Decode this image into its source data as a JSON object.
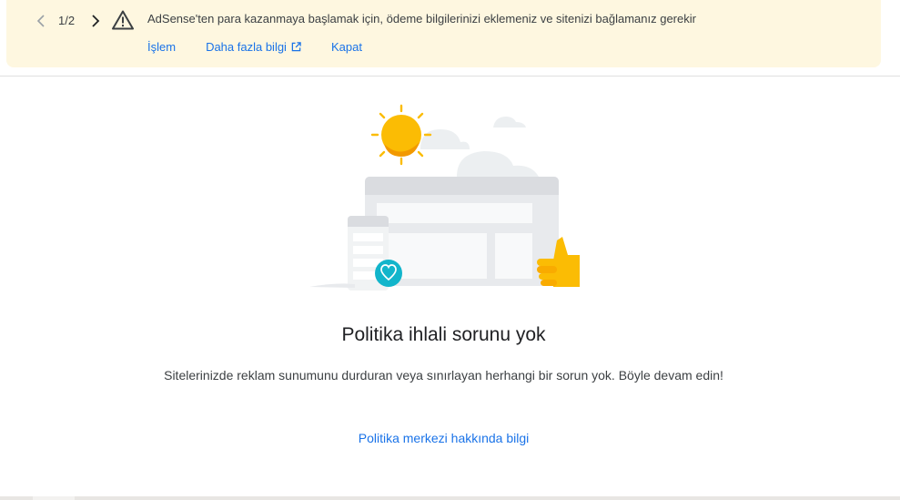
{
  "banner": {
    "pager": "1/2",
    "message": "AdSense'ten para kazanmaya başlamak için, ödeme bilgilerinizi eklemeniz ve sitenizi bağlamanız gerekir",
    "actions": {
      "action_label": "İşlem",
      "more_info_label": "Daha fazla bilgi",
      "close_label": "Kapat"
    },
    "icons": {
      "prev": "chevron-left-icon",
      "next": "chevron-right-icon",
      "warning": "warning-triangle-icon",
      "external": "open-in-new-icon"
    }
  },
  "empty_state": {
    "title": "Politika ihlali sorunu yok",
    "description": "Sitelerinizde reklam sunumunu durduran veya sınırlayan herhangi bir sorun yok. Böyle devam edin!",
    "link": "Politika merkezi hakkında bilgi",
    "illustration": "sunny-website-thumbs-up-illustration"
  },
  "colors": {
    "banner_bg": "#fef7e0",
    "link": "#1a73e8",
    "sun": "#fbbc04",
    "heart_badge": "#12b5cb"
  }
}
